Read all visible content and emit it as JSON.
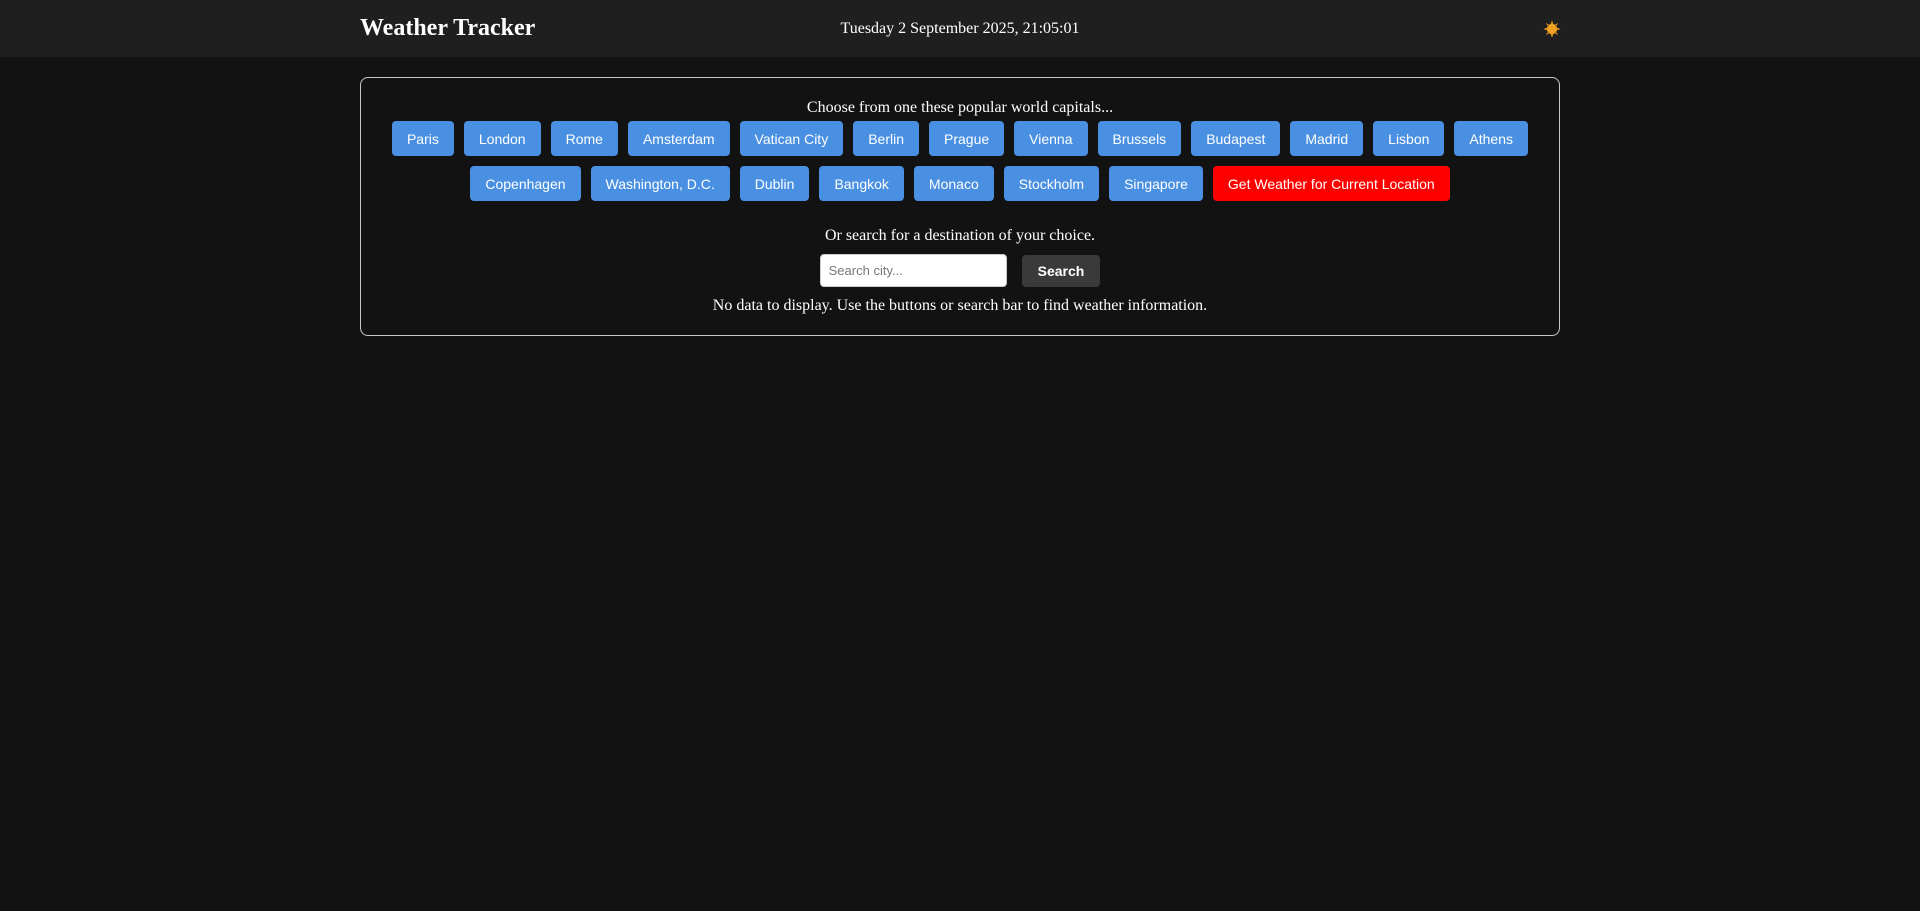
{
  "header": {
    "title": "Weather Tracker",
    "datetime": "Tuesday 2 September 2025, 21:05:01",
    "theme_icon": "sun-icon",
    "theme_icon_color": "#f0a020"
  },
  "panel": {
    "intro": "Choose from one these popular world capitals...",
    "cities_row1": [
      "Paris",
      "London",
      "Rome",
      "Amsterdam",
      "Vatican City",
      "Berlin",
      "Prague",
      "Vienna",
      "Brussels",
      "Budapest",
      "Madrid",
      "Lisbon",
      "Athens"
    ],
    "cities_row2": [
      "Copenhagen",
      "Washington, D.C.",
      "Dublin",
      "Bangkok",
      "Monaco",
      "Stockholm",
      "Singapore"
    ],
    "location_button": "Get Weather for Current Location",
    "search_intro": "Or search for a destination of your choice.",
    "search": {
      "placeholder": "Search city...",
      "value": "",
      "button": "Search"
    },
    "empty_message": "No data to display. Use the buttons or search bar to find weather information."
  },
  "colors": {
    "city_button": "#4a90e2",
    "location_button": "#ff0000",
    "search_button": "#3a3a3a",
    "background": "#121212",
    "header_background": "#1f1f1f"
  }
}
